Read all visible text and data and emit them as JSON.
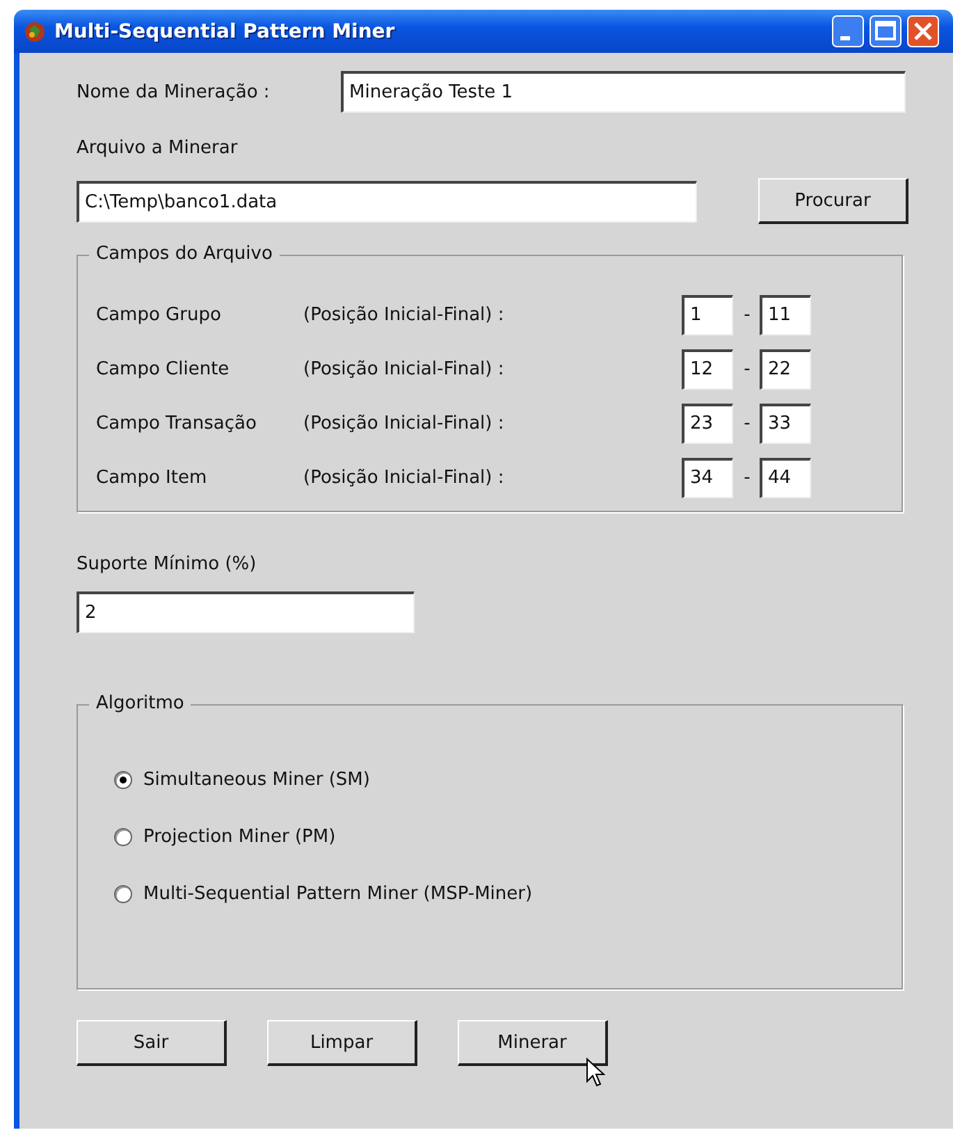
{
  "window": {
    "title": "Multi-Sequential Pattern Miner"
  },
  "name_field": {
    "label": "Nome da Mineração :",
    "value": "Mineração Teste 1"
  },
  "file": {
    "label": "Arquivo a Minerar",
    "value": "C:\\Temp\\banco1.data",
    "browse_button": "Procurar"
  },
  "fields_group": {
    "title": "Campos do Arquivo",
    "rows": [
      {
        "name": "Campo Grupo",
        "range_label": "(Posição Inicial-Final) :",
        "start": "1",
        "separator": "-",
        "end": "11"
      },
      {
        "name": "Campo Cliente",
        "range_label": "(Posição Inicial-Final) :",
        "start": "12",
        "separator": "-",
        "end": "22"
      },
      {
        "name": "Campo Transação",
        "range_label": "(Posição Inicial-Final) :",
        "start": "23",
        "separator": "-",
        "end": "33"
      },
      {
        "name": "Campo Item",
        "range_label": "(Posição Inicial-Final) :",
        "start": "34",
        "separator": "-",
        "end": "44"
      }
    ]
  },
  "support": {
    "label": "Suporte Mínimo (%)",
    "value": "2"
  },
  "algorithm_group": {
    "title": "Algoritmo",
    "options": [
      {
        "label": "Simultaneous Miner (SM)",
        "selected": true
      },
      {
        "label": "Projection Miner (PM)",
        "selected": false
      },
      {
        "label": "Multi-Sequential Pattern Miner (MSP-Miner)",
        "selected": false
      }
    ]
  },
  "buttons": [
    "Sair",
    "Limpar",
    "Minerar"
  ]
}
